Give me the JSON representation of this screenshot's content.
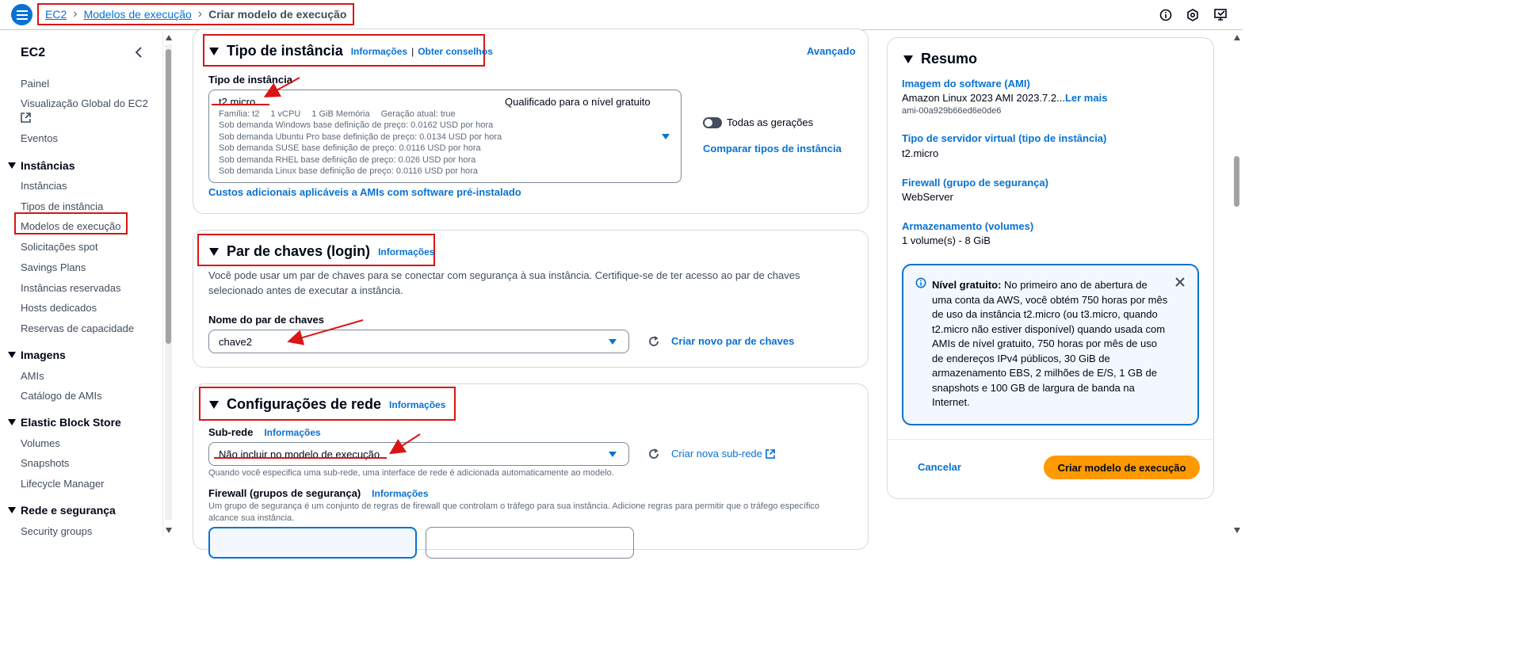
{
  "breadcrumb": {
    "root": "EC2",
    "parent": "Modelos de execução",
    "current": "Criar modelo de execução"
  },
  "topbar_icons": [
    "info-circle-icon",
    "settings-hex-icon",
    "notifications-icon"
  ],
  "sidebar": {
    "title": "EC2",
    "top_items": [
      "Painel",
      "Visualização Global do EC2",
      "Eventos"
    ],
    "sections": [
      {
        "label": "Instâncias",
        "items": [
          "Instâncias",
          "Tipos de instância",
          "Modelos de execução",
          "Solicitações spot",
          "Savings Plans",
          "Instâncias reservadas",
          "Hosts dedicados",
          "Reservas de capacidade"
        ]
      },
      {
        "label": "Imagens",
        "items": [
          "AMIs",
          "Catálogo de AMIs"
        ]
      },
      {
        "label": "Elastic Block Store",
        "items": [
          "Volumes",
          "Snapshots",
          "Lifecycle Manager"
        ]
      },
      {
        "label": "Rede e segurança",
        "items": [
          "Security groups"
        ]
      }
    ]
  },
  "instance_type": {
    "title": "Tipo de instância",
    "info": "Informações",
    "sep": "|",
    "advice": "Obter conselhos",
    "advanced": "Avançado",
    "field_label": "Tipo de instância",
    "selected": "t2.micro",
    "free_tier": "Qualificado para o nível gratuito",
    "specs": [
      "Família: t2",
      "1 vCPU",
      "1 GiB Memória",
      "Geração atual: true"
    ],
    "pricing": [
      "Sob demanda Windows base definição de preço: 0.0162 USD por hora",
      "Sob demanda Ubuntu Pro base definição de preço: 0.0134 USD por hora",
      "Sob demanda SUSE base definição de preço: 0.0116 USD por hora",
      "Sob demanda RHEL base definição de preço: 0.026 USD por hora",
      "Sob demanda Linux base definição de preço: 0.0116 USD por hora"
    ],
    "all_generations": "Todas as gerações",
    "compare": "Comparar tipos de instância",
    "additional_costs": "Custos adicionais aplicáveis a AMIs com software pré-instalado"
  },
  "key_pair": {
    "title": "Par de chaves (login)",
    "info": "Informações",
    "description": "Você pode usar um par de chaves para se conectar com segurança à sua instância. Certifique-se de ter acesso ao par de chaves selecionado antes de executar a instância.",
    "field_label": "Nome do par de chaves",
    "selected": "chave2",
    "create_new": "Criar novo par de chaves"
  },
  "network": {
    "title": "Configurações de rede",
    "info": "Informações",
    "subnet_label": "Sub-rede",
    "subnet_info": "Informações",
    "subnet_selected": "Não incluir no modelo de execução",
    "create_subnet": "Criar nova sub-rede",
    "subnet_hint": "Quando você especifica uma sub-rede, uma interface de rede é adicionada automaticamente ao modelo.",
    "firewall_label": "Firewall (grupos de segurança)",
    "firewall_info": "Informações",
    "firewall_desc": "Um grupo de segurança é um conjunto de regras de firewall que controlam o tráfego para sua instância. Adicione regras para permitir que o tráfego específico alcance sua instância."
  },
  "summary": {
    "title": "Resumo",
    "ami_label": "Imagem do software (AMI)",
    "ami_value": "Amazon Linux 2023 AMI 2023.7.2...",
    "ami_more": "Ler mais",
    "ami_id": "ami-00a929b66ed6e0de6",
    "server_label": "Tipo de servidor virtual (tipo de instância)",
    "server_value": "t2.micro",
    "firewall_label": "Firewall (grupo de segurança)",
    "firewall_value": "WebServer",
    "storage_label": "Armazenamento (volumes)",
    "storage_value": "1 volume(s) - 8 GiB",
    "free_tier_bold": "Nível gratuito:",
    "free_tier_text": " No primeiro ano de abertura de uma conta da AWS, você obtém 750 horas por mês de uso da instância t2.micro (ou t3.micro, quando t2.micro não estiver disponível) quando usada com AMIs de nível gratuito, 750 horas por mês de uso de endereços IPv4 públicos, 30 GiB de armazenamento EBS, 2 milhões de E/S, 1 GB de snapshots e 100 GB de largura de banda na Internet.",
    "cancel": "Cancelar",
    "create": "Criar modelo de execução"
  },
  "colors": {
    "accent": "#0972d3",
    "annotation": "#d91515",
    "primary_button": "#ff9900"
  }
}
